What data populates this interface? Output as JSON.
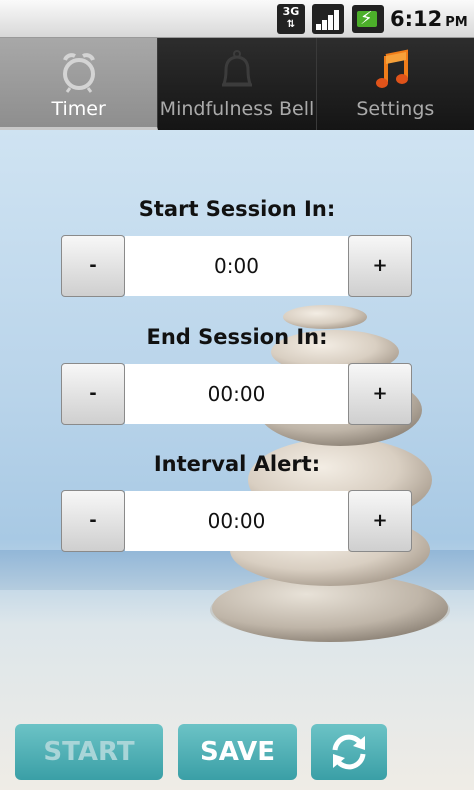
{
  "status_bar": {
    "network": "3G",
    "time": "6:12",
    "ampm": "PM"
  },
  "tabs": [
    {
      "label": "Timer",
      "icon": "alarm-clock-icon",
      "active": true
    },
    {
      "label": "Mindfulness Bell",
      "icon": "bell-icon",
      "active": false
    },
    {
      "label": "Settings",
      "icon": "music-notes-icon",
      "active": false
    }
  ],
  "fields": {
    "start_session": {
      "label": "Start Session In:",
      "value": "0:00",
      "minus": "-",
      "plus": "+"
    },
    "end_session": {
      "label": "End Session In:",
      "value": "00:00",
      "minus": "-",
      "plus": "+"
    },
    "interval_alert": {
      "label": "Interval Alert:",
      "value": "00:00",
      "minus": "-",
      "plus": "+"
    }
  },
  "actions": {
    "start_label": "START",
    "save_label": "SAVE",
    "refresh_icon": "refresh-icon"
  },
  "colors": {
    "action_button": "#4fb1b7",
    "active_tab": "#9c9c9c",
    "settings_icon": "#f07d1a"
  }
}
